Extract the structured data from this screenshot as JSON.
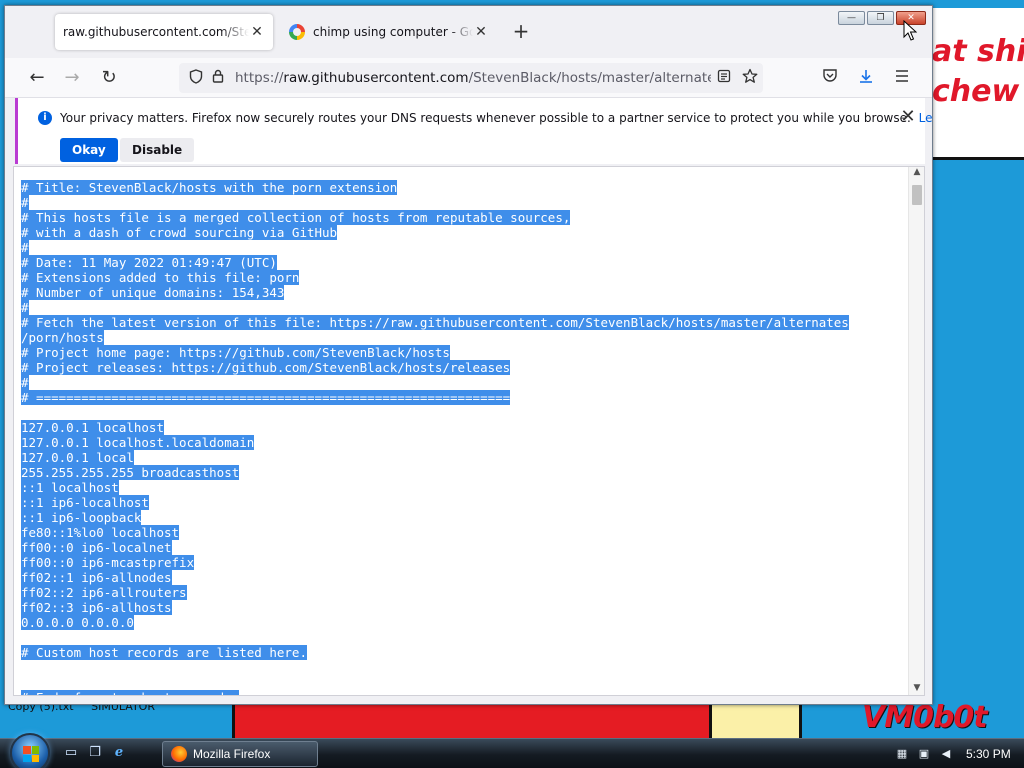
{
  "desktop": {
    "paper_lines": [
      "at shit",
      "chew"
    ],
    "caption_items": [
      "Copy (5).txt",
      "SIMULATOR"
    ],
    "logo": "VM0b0t"
  },
  "browser": {
    "window_controls": {
      "minimize": "—",
      "maximize": "❐",
      "close": "✕"
    },
    "tabs": [
      {
        "title": "raw.githubusercontent.com/StevenBlack/hosts/master/alternates/porn/hosts",
        "active": true,
        "close": "✕"
      },
      {
        "title": "chimp using computer - Google Search",
        "active": false,
        "close": "✕"
      }
    ],
    "new_tab": "+",
    "nav": {
      "back": "←",
      "forward": "→",
      "reload": "↻"
    },
    "url": {
      "prefix": "https://",
      "host": "raw.githubusercontent.com",
      "path": "/StevenBlack/hosts/master/alternates/porn/hosts"
    },
    "notification": {
      "message": "Your privacy matters. Firefox now securely routes your DNS requests whenever possible to a partner service to protect you while you browse.",
      "link": "Learn more",
      "primary_button": "Okay",
      "secondary_button": "Disable",
      "close": "✕"
    },
    "content_lines": [
      "# Title: StevenBlack/hosts with the porn extension",
      "#",
      "# This hosts file is a merged collection of hosts from reputable sources,",
      "# with a dash of crowd sourcing via GitHub",
      "#",
      "# Date: 11 May 2022 01:49:47 (UTC)",
      "# Extensions added to this file: porn",
      "# Number of unique domains: 154,343",
      "#",
      "# Fetch the latest version of this file: https://raw.githubusercontent.com/StevenBlack/hosts/master/alternates",
      "/porn/hosts",
      "# Project home page: https://github.com/StevenBlack/hosts",
      "# Project releases: https://github.com/StevenBlack/hosts/releases",
      "#",
      "# ===============================================================",
      "",
      "127.0.0.1 localhost",
      "127.0.0.1 localhost.localdomain",
      "127.0.0.1 local",
      "255.255.255.255 broadcasthost",
      "::1 localhost",
      "::1 ip6-localhost",
      "::1 ip6-loopback",
      "fe80::1%lo0 localhost",
      "ff00::0 ip6-localnet",
      "ff00::0 ip6-mcastprefix",
      "ff02::1 ip6-allnodes",
      "ff02::2 ip6-allrouters",
      "ff02::3 ip6-allhosts",
      "0.0.0.0 0.0.0.0",
      "",
      "# Custom host records are listed here.",
      "",
      "",
      "# End of custom host records."
    ]
  },
  "taskbar": {
    "task_button": "Mozilla Firefox",
    "clock": "5:30 PM",
    "quick_launch": [
      "show-desktop-icon",
      "switch-windows-icon",
      "internet-explorer-icon"
    ]
  },
  "colors": {
    "selection": "#3f8eea",
    "accent": "#0061e0",
    "desktop": "#1d9ad8"
  }
}
